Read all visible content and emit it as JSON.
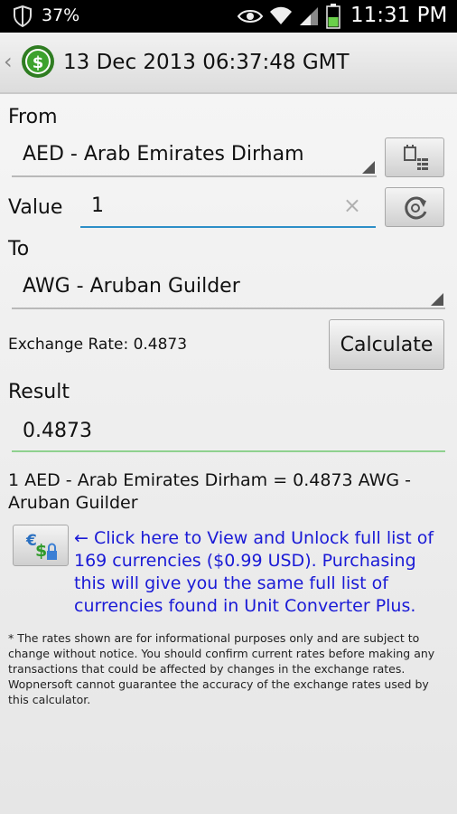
{
  "status_bar": {
    "battery_percent": "37%",
    "time": "11:31 PM",
    "icons": [
      "shield-icon",
      "eye-icon",
      "wifi-icon",
      "signal-icon",
      "battery-icon"
    ]
  },
  "action_bar": {
    "title": "13 Dec 2013 06:37:48 GMT",
    "logo_icon": "dollar-coin-icon"
  },
  "from": {
    "label": "From",
    "selected": "AED - Arab Emirates Dirham"
  },
  "value": {
    "label": "Value",
    "current": "1",
    "clear_icon": "×"
  },
  "to": {
    "label": "To",
    "selected": "AWG - Aruban Guilder"
  },
  "exchange_rate_text": "Exchange Rate: 0.4873",
  "calculate_label": "Calculate",
  "result": {
    "label": "Result",
    "value": "0.4873"
  },
  "conversion_text": "1 AED - Arab Emirates Dirham = 0.4873 AWG - Aruban Guilder",
  "unlock_text": "← Click here to View and Unlock full list of 169 currencies ($0.99 USD). Purchasing this will give you the same full list of currencies found in Unit Converter Plus.",
  "disclaimer": "* The rates shown are for informational purposes only and are subject to change without notice. You should confirm current rates before making any transactions that could be affected by changes in the exchange rates. Wopnersoft cannot guarantee the accuracy of the exchange rates used by this calculator.",
  "colors": {
    "link": "#1a1ad6",
    "value_underline": "#2d8fc7",
    "result_underline": "#8fd18f",
    "status_bar_bg": "#000000"
  }
}
